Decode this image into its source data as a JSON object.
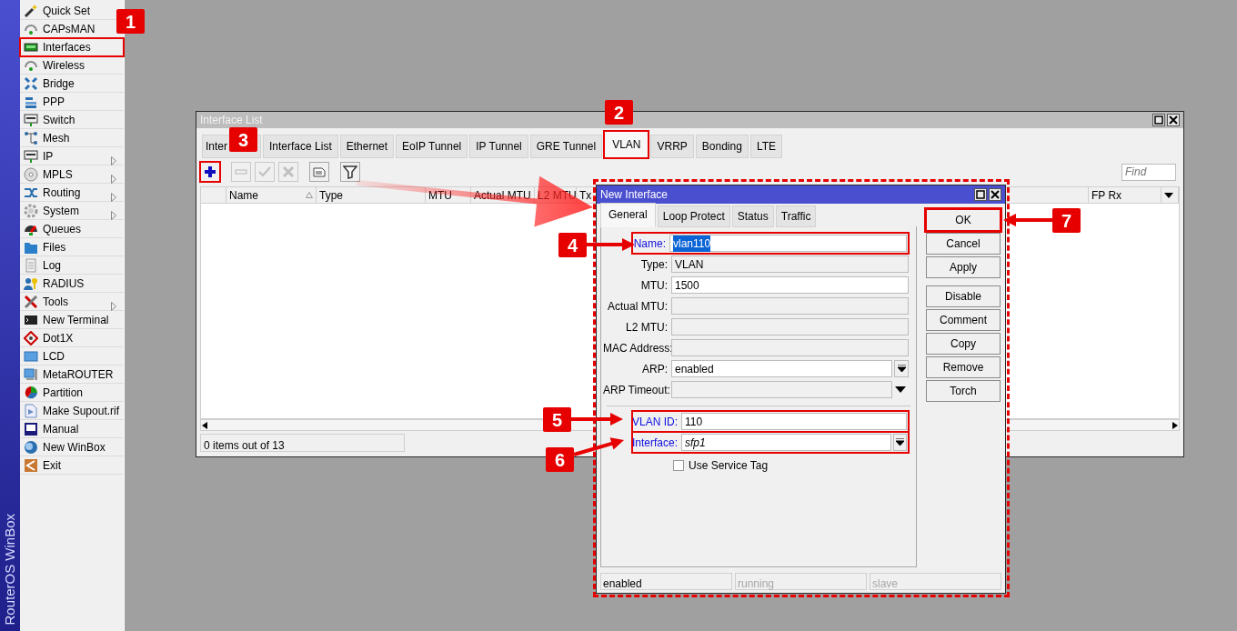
{
  "sidebar": {
    "brand": "RouterOS WinBox",
    "items": [
      {
        "label": "Quick Set",
        "submenu": false
      },
      {
        "label": "CAPsMAN",
        "submenu": false
      },
      {
        "label": "Interfaces",
        "submenu": false,
        "callout": "1"
      },
      {
        "label": "Wireless",
        "submenu": false
      },
      {
        "label": "Bridge",
        "submenu": false
      },
      {
        "label": "PPP",
        "submenu": false
      },
      {
        "label": "Switch",
        "submenu": false
      },
      {
        "label": "Mesh",
        "submenu": false
      },
      {
        "label": "IP",
        "submenu": true
      },
      {
        "label": "MPLS",
        "submenu": true
      },
      {
        "label": "Routing",
        "submenu": true
      },
      {
        "label": "System",
        "submenu": true
      },
      {
        "label": "Queues",
        "submenu": false
      },
      {
        "label": "Files",
        "submenu": false
      },
      {
        "label": "Log",
        "submenu": false
      },
      {
        "label": "RADIUS",
        "submenu": false
      },
      {
        "label": "Tools",
        "submenu": true
      },
      {
        "label": "New Terminal",
        "submenu": false
      },
      {
        "label": "Dot1X",
        "submenu": false
      },
      {
        "label": "LCD",
        "submenu": false
      },
      {
        "label": "MetaROUTER",
        "submenu": false
      },
      {
        "label": "Partition",
        "submenu": false
      },
      {
        "label": "Make Supout.rif",
        "submenu": false
      },
      {
        "label": "Manual",
        "submenu": false
      },
      {
        "label": "New WinBox",
        "submenu": false
      },
      {
        "label": "Exit",
        "submenu": false
      }
    ]
  },
  "interface_list": {
    "title": "Interface List",
    "tabs": [
      {
        "label": "Inter",
        "selected": false
      },
      {
        "label": "Interface List",
        "selected": false
      },
      {
        "label": "Ethernet",
        "selected": false
      },
      {
        "label": "EoIP Tunnel",
        "selected": false
      },
      {
        "label": "IP Tunnel",
        "selected": false
      },
      {
        "label": "GRE Tunnel",
        "selected": false
      },
      {
        "label": "VLAN",
        "selected": true,
        "callout": "2"
      },
      {
        "label": "VRRP",
        "selected": false
      },
      {
        "label": "Bonding",
        "selected": false
      },
      {
        "label": "LTE",
        "selected": false
      }
    ],
    "toolbar": [
      {
        "kind": "add",
        "disabled": false,
        "callout": "3"
      },
      {
        "kind": "remove",
        "disabled": true
      },
      {
        "kind": "enable",
        "disabled": true
      },
      {
        "kind": "disable",
        "disabled": true
      },
      {
        "kind": "comment",
        "disabled": false
      },
      {
        "kind": "filter",
        "disabled": false
      }
    ],
    "find": {
      "placeholder": "Find"
    },
    "columns": [
      "",
      "Name",
      "Type",
      "MTU",
      "Actual MTU",
      "L2 MTU",
      "Tx",
      "FP Rx"
    ],
    "status": "0 items out of 13"
  },
  "new_interface": {
    "title": "New Interface",
    "tabs": [
      {
        "label": "General",
        "selected": true
      },
      {
        "label": "Loop Protect",
        "selected": false
      },
      {
        "label": "Status",
        "selected": false
      },
      {
        "label": "Traffic",
        "selected": false
      }
    ],
    "fields": [
      {
        "label": "Name:",
        "value": "vlan110",
        "kind": "text",
        "required": true,
        "italic": false,
        "text_selected": true,
        "callout": "4"
      },
      {
        "label": "Type:",
        "value": "VLAN",
        "kind": "readonly",
        "required": false,
        "italic": false
      },
      {
        "label": "MTU:",
        "value": "1500",
        "kind": "text",
        "required": false,
        "italic": false
      },
      {
        "label": "Actual MTU:",
        "kind": "readonly",
        "required": false
      },
      {
        "label": "L2 MTU:",
        "kind": "readonly",
        "required": false
      },
      {
        "label": "MAC Address:",
        "kind": "readonly",
        "required": false
      },
      {
        "label": "ARP:",
        "value": "enabled",
        "kind": "dropdown",
        "required": false,
        "italic": false
      },
      {
        "label": "ARP Timeout:",
        "kind": "optional",
        "required": false
      },
      {
        "kind": "separator"
      },
      {
        "label": "VLAN ID:",
        "value": "110",
        "kind": "text",
        "required": true,
        "italic": false,
        "callout": "5"
      },
      {
        "label": "Interface:",
        "value": "sfp1",
        "kind": "dropdown",
        "required": true,
        "italic": true,
        "callout": "6"
      }
    ],
    "checkbox": {
      "label": "Use Service Tag",
      "checked": false
    },
    "buttons": [
      {
        "label": "OK",
        "callout": "7"
      },
      {
        "label": "Cancel"
      },
      {
        "label": "Apply"
      },
      {
        "label": "Disable"
      },
      {
        "label": "Comment"
      },
      {
        "label": "Copy"
      },
      {
        "label": "Remove"
      },
      {
        "label": "Torch"
      }
    ],
    "status_bar": [
      {
        "text": "enabled",
        "disabled": false
      },
      {
        "text": "running",
        "disabled": true
      },
      {
        "text": "slave",
        "disabled": true
      }
    ]
  }
}
